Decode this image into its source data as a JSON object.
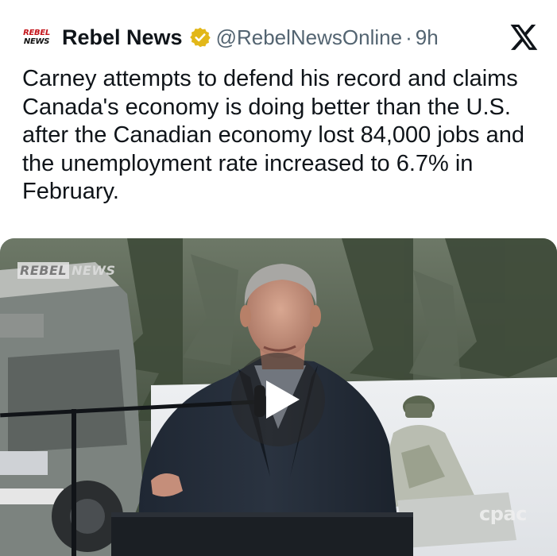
{
  "tweet": {
    "avatar_line1": "REBEL",
    "avatar_line2": "NEWS",
    "display_name": "Rebel News",
    "handle": "@RebelNewsOnline",
    "separator": "·",
    "time": "9h",
    "text": "Carney attempts to defend his record and claims Canada's economy is doing better than the U.S. after the Canadian economy lost 84,000 jobs and the unemployment rate increased to 6.7% in February."
  },
  "media": {
    "watermark_part1": "REBEL",
    "watermark_part2": "NEWS",
    "broadcaster_logo": "cpac",
    "play_icon": "play-icon"
  },
  "icons": {
    "verified": "verified-badge-icon",
    "platform": "x-logo-icon"
  },
  "colors": {
    "text": "#0f1419",
    "secondary": "#536471",
    "verified_gold": "#e2b719",
    "brand_red": "#c4161c"
  }
}
